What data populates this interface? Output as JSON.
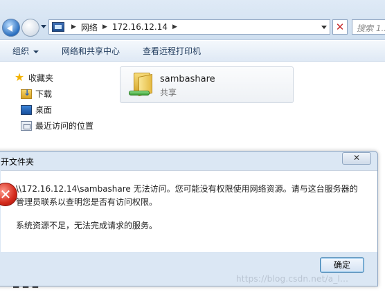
{
  "address_bar": {
    "crumbs": [
      "网络",
      "172.16.12.14"
    ],
    "search_placeholder": "搜索 1..."
  },
  "toolbar": {
    "items": [
      "组织",
      "网络和共享中心",
      "查看远程打印机"
    ]
  },
  "nav": {
    "favorites_label": "收藏夹",
    "items": [
      "下载",
      "桌面",
      "最近访问的位置"
    ]
  },
  "share": {
    "name": "sambashare",
    "type": "共享"
  },
  "dialog": {
    "title": "开文件夹",
    "close_label": "✕",
    "message_line1": "\\\\172.16.12.14\\sambashare 无法访问。您可能没有权限使用网络资源。请与这台服务器的管理员联系以查明您是否有访问权限。",
    "message_line2": "系统资源不足，无法完成请求的服务。",
    "ok_label": "确定"
  },
  "watermark": "https://blog.csdn.net/a_l..."
}
